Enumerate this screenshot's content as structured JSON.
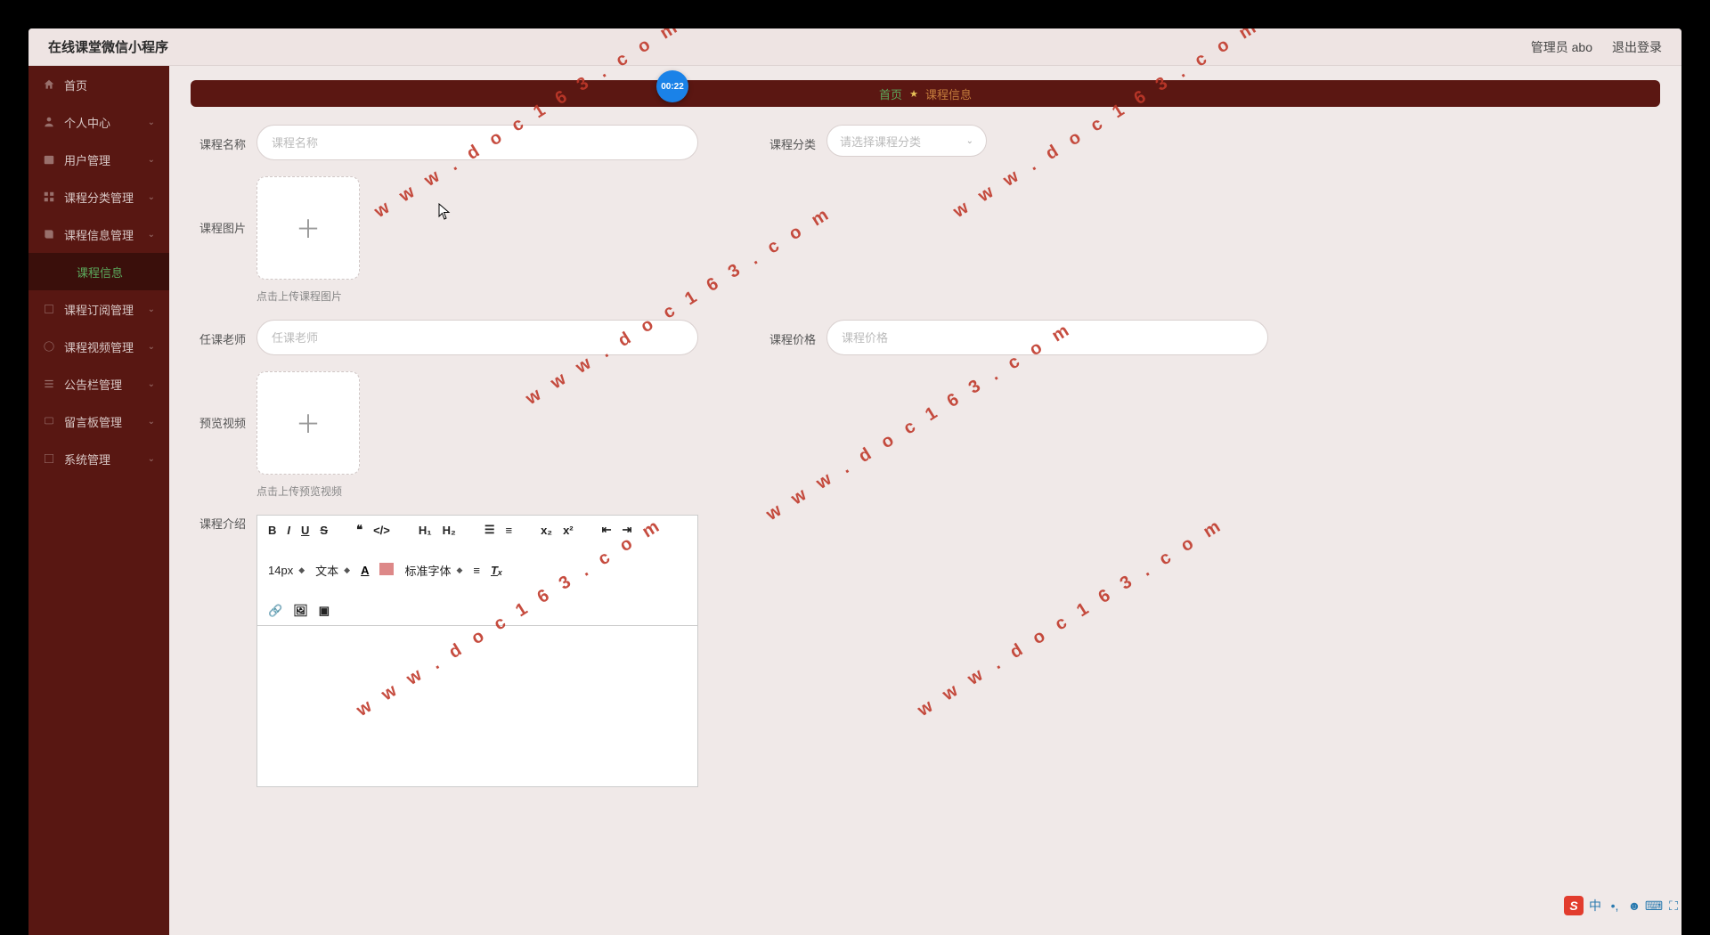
{
  "topbar": {
    "brand": "在线课堂微信小程序",
    "user_label": "管理员 abo",
    "logout_label": "退出登录"
  },
  "timer": {
    "value": "00:22"
  },
  "sidebar": {
    "items": [
      {
        "label": "首页"
      },
      {
        "label": "个人中心"
      },
      {
        "label": "用户管理"
      },
      {
        "label": "课程分类管理"
      },
      {
        "label": "课程信息管理"
      },
      {
        "label": "课程信息"
      },
      {
        "label": "课程订阅管理"
      },
      {
        "label": "课程视频管理"
      },
      {
        "label": "公告栏管理"
      },
      {
        "label": "留言板管理"
      },
      {
        "label": "系统管理"
      }
    ]
  },
  "breadcrumb": {
    "home": "首页",
    "current": "课程信息"
  },
  "form": {
    "course_name": {
      "label": "课程名称",
      "placeholder": "课程名称",
      "value": ""
    },
    "course_category": {
      "label": "课程分类",
      "placeholder": "请选择课程分类"
    },
    "course_image": {
      "label": "课程图片",
      "hint": "点击上传课程图片"
    },
    "teacher": {
      "label": "任课老师",
      "placeholder": "任课老师",
      "value": ""
    },
    "course_price": {
      "label": "课程价格",
      "placeholder": "课程价格",
      "value": ""
    },
    "preview_video": {
      "label": "预览视频",
      "hint": "点击上传预览视频"
    },
    "course_intro": {
      "label": "课程介绍"
    }
  },
  "editor_toolbar": {
    "font_size": "14px",
    "block_type": "文本",
    "font_family": "标准字体"
  },
  "watermark": "w w w . d o c 1 6 3 . c o m",
  "ime": {
    "zh": "中"
  }
}
